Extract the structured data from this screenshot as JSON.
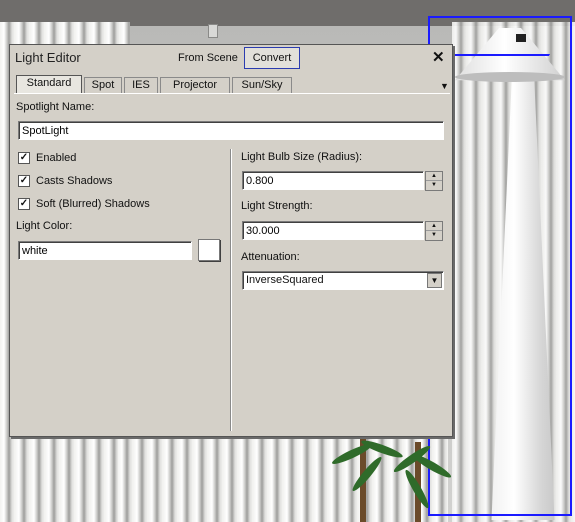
{
  "panel": {
    "title": "Light Editor",
    "from_scene_label": "From Scene",
    "convert_label": "Convert",
    "close_symbol": "✕"
  },
  "tabs": [
    {
      "label": "Standard",
      "active": true
    },
    {
      "label": "Spot",
      "active": false
    },
    {
      "label": "IES",
      "active": false
    },
    {
      "label": "Projector",
      "active": false
    },
    {
      "label": "Sun/Sky",
      "active": false
    }
  ],
  "tab_menu_symbol": "▼",
  "form": {
    "spotlight_name_label": "Spotlight Name:",
    "spotlight_name_value": "SpotLight",
    "enabled_label": "Enabled",
    "enabled_checked": true,
    "casts_shadows_label": "Casts Shadows",
    "casts_shadows_checked": true,
    "soft_shadows_label": "Soft (Blurred) Shadows",
    "soft_shadows_checked": true,
    "light_color_label": "Light Color:",
    "light_color_value": "white",
    "light_color_swatch": "#ffffff",
    "bulb_size_label": "Light Bulb Size (Radius):",
    "bulb_size_value": "0.800",
    "strength_label": "Light Strength:",
    "strength_value": "30.000",
    "attenuation_label": "Attenuation:",
    "attenuation_value": "InverseSquared"
  },
  "colors": {
    "panel_bg": "#d4d0c8",
    "selection": "#1b1bff"
  }
}
